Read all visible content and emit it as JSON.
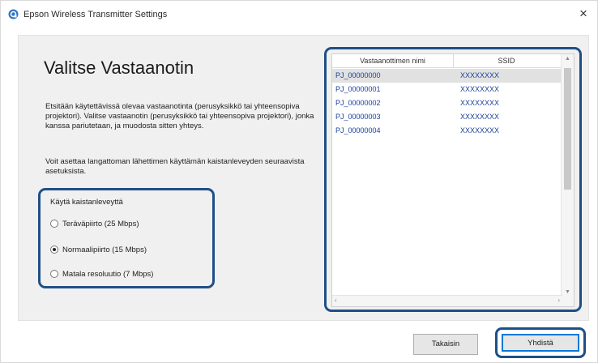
{
  "window": {
    "title": "Epson Wireless Transmitter Settings",
    "close_glyph": "×"
  },
  "main": {
    "heading": "Valitse Vastaanotin",
    "description": "Etsitään käytettävissä olevaa vastaanotinta (perusyksikkö tai yhteensopiva projektori). Valitse vastaanotin (perusyksikkö tai yhteensopiva projektori), jonka kanssa pariutetaan, ja muodosta sitten yhteys.",
    "bandwidth_info": "Voit asettaa langattoman lähettimen käyttämän kaistanleveyden seuraavista asetuksista."
  },
  "bandwidth": {
    "label": "Käytä kaistanleveyttä",
    "options": [
      {
        "label": "Teräväpiirto (25 Mbps)",
        "checked": false
      },
      {
        "label": "Normaalipiirto (15 Mbps)",
        "checked": true
      },
      {
        "label": "Matala resoluutio (7 Mbps)",
        "checked": false
      }
    ]
  },
  "receivers": {
    "columns": {
      "name": "Vastaanottimen nimi",
      "ssid": "SSID"
    },
    "rows": [
      {
        "name": "PJ_00000000",
        "ssid": "XXXXXXXX",
        "selected": true
      },
      {
        "name": "PJ_00000001",
        "ssid": "XXXXXXXX",
        "selected": false
      },
      {
        "name": "PJ_00000002",
        "ssid": "XXXXXXXX",
        "selected": false
      },
      {
        "name": "PJ_00000003",
        "ssid": "XXXXXXXX",
        "selected": false
      },
      {
        "name": "PJ_00000004",
        "ssid": "XXXXXXXX",
        "selected": false
      }
    ]
  },
  "footer": {
    "back_label": "Takaisin",
    "connect_label": "Yhdistä"
  },
  "icons": {
    "app": "epson-app-icon",
    "close": "close-icon"
  },
  "colors": {
    "highlight_frame": "#1f4f86",
    "list_text": "#1b3f9a",
    "focus_border": "#0078d7"
  }
}
